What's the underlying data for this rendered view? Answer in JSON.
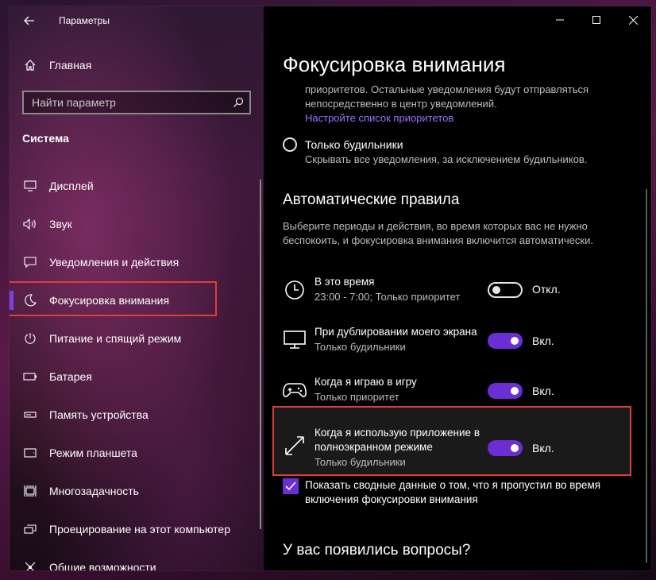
{
  "window": {
    "app_title": "Параметры",
    "controls": [
      "minimize-icon",
      "maximize-icon",
      "close-icon"
    ]
  },
  "sidebar": {
    "home_label": "Главная",
    "search_placeholder": "Найти параметр",
    "section_title": "Система",
    "items": [
      {
        "label": "Дисплей",
        "icon": "display-icon"
      },
      {
        "label": "Звук",
        "icon": "speaker-icon"
      },
      {
        "label": "Уведомления и действия",
        "icon": "notification-icon"
      },
      {
        "label": "Фокусировка внимания",
        "icon": "moon-icon",
        "active": true
      },
      {
        "label": "Питание и спящий режим",
        "icon": "power-icon"
      },
      {
        "label": "Батарея",
        "icon": "battery-icon"
      },
      {
        "label": "Память устройства",
        "icon": "storage-icon"
      },
      {
        "label": "Режим планшета",
        "icon": "tablet-icon"
      },
      {
        "label": "Многозадачность",
        "icon": "multitask-icon"
      },
      {
        "label": "Проецирование на этот компьютер",
        "icon": "projection-icon"
      },
      {
        "label": "Общие возможности",
        "icon": "shared-icon"
      }
    ]
  },
  "content": {
    "page_title": "Фокусировка внимания",
    "top_description": "приоритетов. Остальные уведомления будут отправляться непосредственно в центр уведомлений.",
    "priority_link": "Настройте список приоритетов",
    "alarms_only": {
      "title": "Только будильники",
      "description": "Скрывать все уведомления, за исключением будильников."
    },
    "auto_rules": {
      "heading": "Автоматические правила",
      "description": "Выберите периоды и действия, во время которых вас не нужно беспокоить, и фокусировка внимания включится автоматически.",
      "rules": [
        {
          "title": "В это время",
          "subtitle": "23:00 - 7:00; Только приоритет",
          "state": "Откл.",
          "on": false,
          "icon": "clock-icon"
        },
        {
          "title": "При дублировании моего экрана",
          "subtitle": "Только будильники",
          "state": "Вкл.",
          "on": true,
          "icon": "monitor-icon"
        },
        {
          "title": "Когда я играю в игру",
          "subtitle": "Только приоритет",
          "state": "Вкл.",
          "on": true,
          "icon": "gamepad-icon"
        },
        {
          "title": "Когда я использую приложение в полноэкранном режиме",
          "subtitle": "Только будильники",
          "state": "Вкл.",
          "on": true,
          "icon": "fullscreen-icon"
        }
      ]
    },
    "summary_checkbox": {
      "label": "Показать сводные данные о том, что я пропустил во время включения фокусировки внимания",
      "checked": true
    },
    "questions_heading": "У вас появились вопросы?"
  },
  "colors": {
    "accent": "#6a2ed4",
    "link": "#9a72ff",
    "highlight": "#e03c3c"
  }
}
